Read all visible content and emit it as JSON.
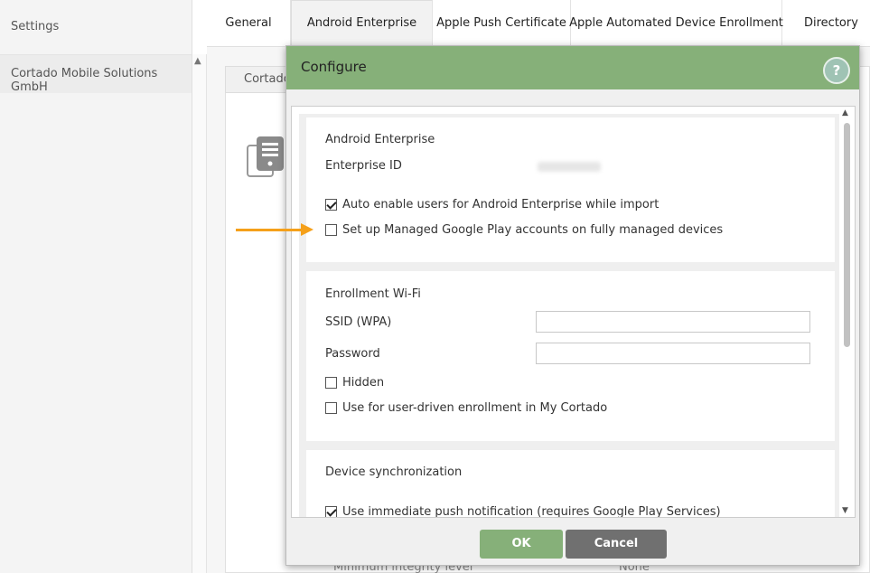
{
  "sidebar": {
    "items": [
      {
        "label": "Settings"
      },
      {
        "label": "Cortado Mobile Solutions GmbH"
      }
    ]
  },
  "tabs": [
    {
      "label": "General"
    },
    {
      "label": "Android Enterprise"
    },
    {
      "label": "Apple Push Certificate"
    },
    {
      "label": "Apple Automated Device Enrollment"
    },
    {
      "label": "Directory"
    }
  ],
  "background": {
    "tab_label": "Cortado",
    "footer_label": "Minimum integrity level",
    "footer_value": "None"
  },
  "modal": {
    "title": "Configure",
    "help": "?",
    "android_section": {
      "title": "Android Enterprise",
      "enterprise_id_label": "Enterprise ID",
      "auto_enable": {
        "label": "Auto enable users for Android Enterprise while import",
        "checked": true
      },
      "managed_play": {
        "label": "Set up Managed Google Play accounts on fully managed devices",
        "checked": false
      }
    },
    "wifi_section": {
      "title": "Enrollment Wi-Fi",
      "ssid_label": "SSID (WPA)",
      "ssid_value": "",
      "password_label": "Password",
      "password_value": "",
      "hidden": {
        "label": "Hidden",
        "checked": false
      },
      "user_driven": {
        "label": "Use for user-driven enrollment in My Cortado",
        "checked": false
      }
    },
    "sync_section": {
      "title": "Device synchronization",
      "push": {
        "label": "Use immediate push notification (requires Google Play Services)",
        "checked": true
      }
    },
    "ok_label": "OK",
    "cancel_label": "Cancel"
  },
  "colors": {
    "header_green": "#86b079",
    "annotation_arrow": "#f5a01a",
    "cancel_gray": "#707070"
  },
  "icons": [
    "server-icon",
    "help-icon",
    "checkbox-icon",
    "scroll-up-icon",
    "scroll-down-icon",
    "arrow-annotation-icon"
  ]
}
